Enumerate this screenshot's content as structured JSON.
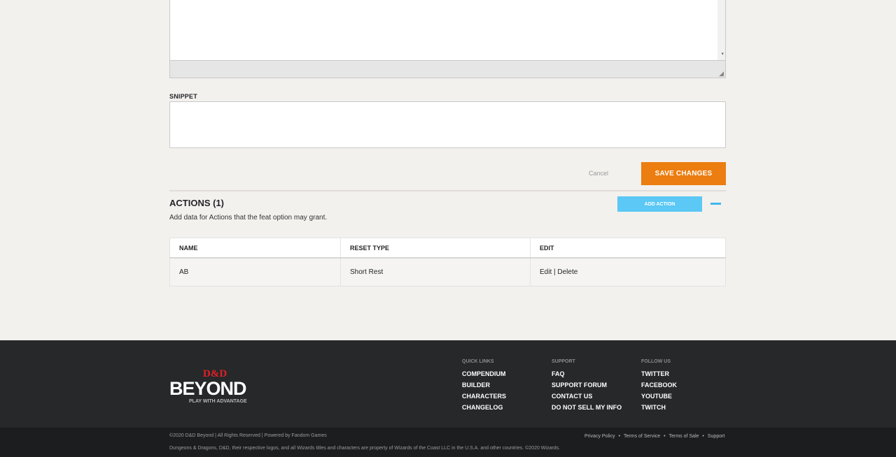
{
  "editor": {
    "scroll_arrow": "▾",
    "resize_glyph": "◢"
  },
  "snippet": {
    "label": "SNIPPET",
    "value": ""
  },
  "form": {
    "cancel_label": "Cancel",
    "save_label": "SAVE CHANGES"
  },
  "actions": {
    "heading": "ACTIONS (1)",
    "description": "Add data for Actions that the feat option may grant.",
    "add_label": "ADD ACTION",
    "columns": [
      "NAME",
      "RESET TYPE",
      "EDIT"
    ],
    "rows": [
      {
        "name": "AB",
        "reset_type": "Short Rest",
        "edit": "Edit",
        "separator": " | ",
        "delete": "Delete"
      }
    ]
  },
  "footer": {
    "logo": {
      "top": "D&D",
      "main": "BEYOND",
      "tagline": "PLAY WITH ADVANTAGE"
    },
    "quick_links": {
      "heading": "QUICK LINKS",
      "items": [
        "COMPENDIUM",
        "BUILDER",
        "CHARACTERS",
        "CHANGELOG"
      ]
    },
    "support": {
      "heading": "SUPPORT",
      "items": [
        "FAQ",
        "SUPPORT FORUM",
        "CONTACT US",
        "DO NOT SELL MY INFO"
      ]
    },
    "follow": {
      "heading": "FOLLOW US",
      "items": [
        "TWITTER",
        "FACEBOOK",
        "YOUTUBE",
        "TWITCH"
      ]
    },
    "copyright": "©2020 D&D Beyond | All Rights Reserved | Powered by Fandom Games",
    "legal": "Dungeons & Dragons, D&D, their respective logos, and all Wizards titles and characters are property of Wizards of the Coast LLC in the U.S.A. and other countries. ©2020 Wizards.",
    "bottom_links": [
      "Privacy Policy",
      "Terms of Service",
      "Terms of Sale",
      "Support"
    ],
    "bullet": "•"
  },
  "colors": {
    "accent_orange": "#ec7d10",
    "accent_blue": "#5bc8f5",
    "footer_bg": "#26282a"
  }
}
